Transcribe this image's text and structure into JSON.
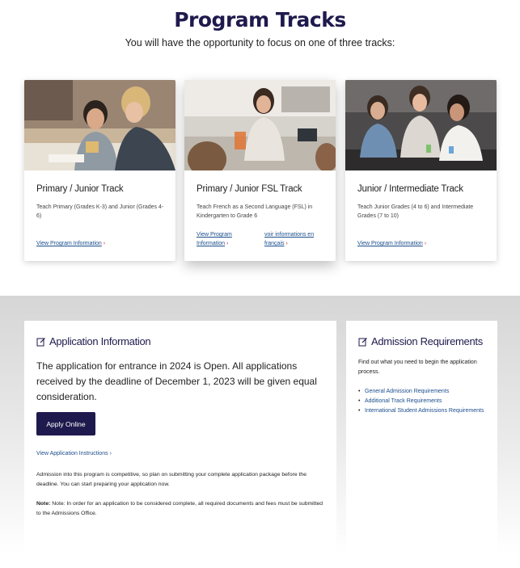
{
  "header": {
    "title": "Program Tracks",
    "subtitle": "You will have the opportunity to focus on one of three tracks:"
  },
  "tracks": [
    {
      "title": "Primary / Junior Track",
      "description": "Teach Primary (Grades K-3) and Junior (Grades 4-6)",
      "links": [
        "View Program Information"
      ]
    },
    {
      "title": "Primary / Junior FSL Track",
      "description": "Teach French as a Second Language (FSL) in Kindergarten to Grade 6",
      "links": [
        "View Program Information",
        "voir informations en français"
      ]
    },
    {
      "title": "Junior / Intermediate Track",
      "description": "Teach Junior Grades (4 to 6) and Intermediate Grades (7 to 10)",
      "links": [
        "View Program Information"
      ]
    }
  ],
  "application": {
    "heading": "Application Information",
    "lead": "The application for entrance in 2024 is Open. All applications received by the deadline of December 1, 2023 will be given equal consideration.",
    "apply_label": "Apply Online",
    "instructions_link": "View Application Instructions",
    "paragraph": "Admission into this program is competitive, so plan on submitting your complete application package before the deadline. You can start preparing your application now.",
    "note_label": "Note:",
    "note_text": "Note: In order for an application to be considered complete, all required documents and fees must be submitted to the Admissions Office."
  },
  "admission": {
    "heading": "Admission Requirements",
    "description": "Find out what you need to begin the application process.",
    "links": [
      "General Admission Requirements",
      "Additional Track Requirements",
      "International Student Admissions Requirements"
    ]
  },
  "colors": {
    "heading_navy": "#1f1a4d",
    "link_blue": "#1a4d8c",
    "chevron_red": "#d0242b",
    "button_bg": "#1f1a4d"
  },
  "icons": {
    "link_chevron": "chevron-right-icon",
    "panel_heading": "edit-icon"
  }
}
